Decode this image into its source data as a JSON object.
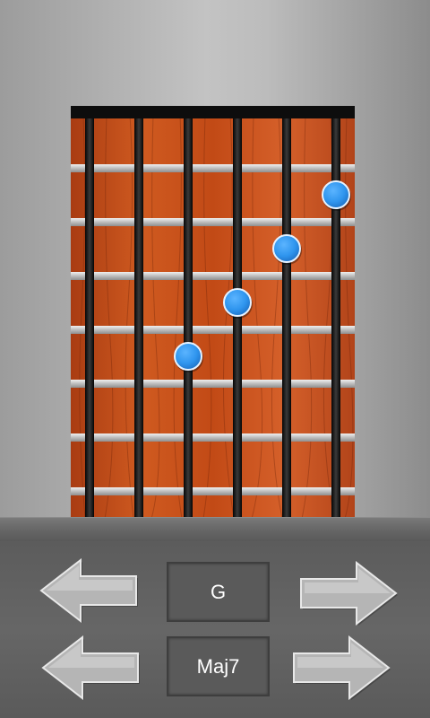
{
  "chord": {
    "root": "G",
    "type": "Maj7"
  },
  "controls": {
    "root_prev_icon": "arrow-left-icon",
    "root_next_icon": "arrow-right-icon",
    "type_prev_icon": "arrow-left-icon",
    "type_next_icon": "arrow-right-icon"
  },
  "fretboard": {
    "strings": 6,
    "frets": 7,
    "finger_positions": [
      {
        "string": 2,
        "fret": 4
      },
      {
        "string": 3,
        "fret": 3
      },
      {
        "string": 4,
        "fret": 2
      },
      {
        "string": 5,
        "fret": 1
      }
    ]
  },
  "colors": {
    "wood": "#c8501c",
    "marker": "#2f95ee",
    "fret": "#cfcfcf",
    "string": "#1a1a1a",
    "nut": "#0d0d0d"
  }
}
